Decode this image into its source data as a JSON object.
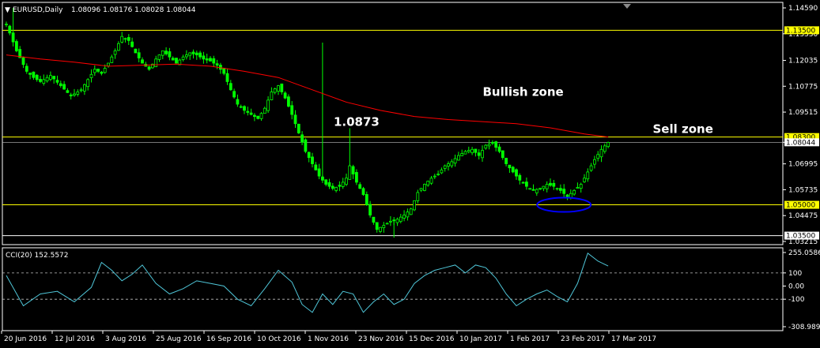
{
  "window": {
    "symbol_caption": "EURUSD,Daily",
    "ohlc_caption": "1.08096 1.08176 1.08028 1.08044",
    "menu_glyph": "▼"
  },
  "chart_data": [
    {
      "type": "candlestick",
      "title": "EURUSD,Daily",
      "ylim": [
        1.03215,
        1.1459
      ],
      "y_ticks": [
        "1.14590",
        "1.13330",
        "1.12035",
        "1.10775",
        "1.09515",
        "1.08044",
        "1.06995",
        "1.05735",
        "1.04475",
        "1.03215"
      ],
      "x_ticks": [
        "20 Jun 2016",
        "12 Jul 2016",
        "3 Aug 2016",
        "25 Aug 2016",
        "16 Sep 2016",
        "10 Oct 2016",
        "1 Nov 2016",
        "23 Nov 2016",
        "15 Dec 2016",
        "10 Jan 2017",
        "1 Feb 2017",
        "23 Feb 2017",
        "17 Mar 2017"
      ],
      "close_path": [
        [
          0,
          1.138
        ],
        [
          3,
          1.125
        ],
        [
          6,
          1.115
        ],
        [
          8,
          1.112
        ],
        [
          10,
          1.11
        ],
        [
          13,
          1.113
        ],
        [
          16,
          1.108
        ],
        [
          19,
          1.103
        ],
        [
          22,
          1.106
        ],
        [
          24,
          1.111
        ],
        [
          26,
          1.116
        ],
        [
          28,
          1.114
        ],
        [
          30,
          1.119
        ],
        [
          32,
          1.125
        ],
        [
          34,
          1.132
        ],
        [
          36,
          1.13
        ],
        [
          38,
          1.124
        ],
        [
          40,
          1.119
        ],
        [
          42,
          1.116
        ],
        [
          44,
          1.121
        ],
        [
          46,
          1.125
        ],
        [
          48,
          1.122
        ],
        [
          50,
          1.119
        ],
        [
          52,
          1.122
        ],
        [
          54,
          1.124
        ],
        [
          56,
          1.123
        ],
        [
          58,
          1.121
        ],
        [
          60,
          1.12
        ],
        [
          62,
          1.118
        ],
        [
          64,
          1.114
        ],
        [
          66,
          1.106
        ],
        [
          68,
          1.099
        ],
        [
          70,
          1.096
        ],
        [
          72,
          1.094
        ],
        [
          74,
          1.092
        ],
        [
          76,
          1.097
        ],
        [
          78,
          1.105
        ],
        [
          80,
          1.108
        ],
        [
          82,
          1.102
        ],
        [
          84,
          1.094
        ],
        [
          86,
          1.085
        ],
        [
          88,
          1.076
        ],
        [
          90,
          1.07
        ],
        [
          92,
          1.064
        ],
        [
          94,
          1.06
        ],
        [
          96,
          1.058
        ],
        [
          98,
          1.059
        ],
        [
          100,
          1.063
        ],
        [
          101,
          1.069
        ],
        [
          103,
          1.061
        ],
        [
          105,
          1.055
        ],
        [
          107,
          1.045
        ],
        [
          109,
          1.038
        ],
        [
          111,
          1.04
        ],
        [
          113,
          1.042
        ],
        [
          115,
          1.043
        ],
        [
          117,
          1.045
        ],
        [
          119,
          1.048
        ],
        [
          121,
          1.056
        ],
        [
          123,
          1.06
        ],
        [
          125,
          1.063
        ],
        [
          127,
          1.065
        ],
        [
          129,
          1.069
        ],
        [
          131,
          1.071
        ],
        [
          133,
          1.074
        ],
        [
          135,
          1.076
        ],
        [
          137,
          1.077
        ],
        [
          139,
          1.074
        ],
        [
          141,
          1.079
        ],
        [
          143,
          1.08
        ],
        [
          145,
          1.076
        ],
        [
          147,
          1.07
        ],
        [
          149,
          1.066
        ],
        [
          151,
          1.062
        ],
        [
          153,
          1.059
        ],
        [
          155,
          1.057
        ],
        [
          157,
          1.058
        ],
        [
          159,
          1.06
        ],
        [
          161,
          1.059
        ],
        [
          163,
          1.057
        ],
        [
          165,
          1.054
        ],
        [
          167,
          1.057
        ],
        [
          169,
          1.06
        ],
        [
          171,
          1.066
        ],
        [
          173,
          1.072
        ],
        [
          175,
          1.077
        ],
        [
          177,
          1.0804
        ]
      ],
      "moving_average": [
        [
          0,
          1.123
        ],
        [
          10,
          1.121
        ],
        [
          20,
          1.1195
        ],
        [
          30,
          1.1175
        ],
        [
          40,
          1.118
        ],
        [
          50,
          1.1185
        ],
        [
          60,
          1.1175
        ],
        [
          70,
          1.115
        ],
        [
          80,
          1.112
        ],
        [
          90,
          1.106
        ],
        [
          100,
          1.1
        ],
        [
          110,
          1.096
        ],
        [
          120,
          1.093
        ],
        [
          130,
          1.0915
        ],
        [
          140,
          1.0905
        ],
        [
          150,
          1.0895
        ],
        [
          160,
          1.0875
        ],
        [
          170,
          1.0845
        ],
        [
          177,
          1.083
        ]
      ],
      "horizontal_levels": [
        {
          "value": 1.135,
          "label": "1.13500",
          "color": "#ffff00"
        },
        {
          "value": 1.083,
          "label": "1.08300",
          "color": "#ffff00"
        },
        {
          "value": 1.05,
          "label": "1.05000",
          "color": "#ffff00"
        },
        {
          "value": 1.035,
          "label": "1.03500",
          "color": "#ffffff"
        }
      ],
      "current_price": {
        "value": 1.08044,
        "label": "1.08044"
      },
      "annotations": [
        {
          "text": "1.0873",
          "x": 103,
          "y": 1.0885
        },
        {
          "text": "Bullish zone",
          "x": 152,
          "y": 1.103
        },
        {
          "text": "Sell zone",
          "x": 199,
          "y": 1.085
        }
      ],
      "ellipse": {
        "x": 164,
        "y": 1.05,
        "color": "#0000ff"
      },
      "colors": {
        "candle": "#00ff00",
        "moving_average": "#ff0000",
        "axis": "#ffffff",
        "background": "#000000"
      }
    },
    {
      "type": "line",
      "title": "CCI(20) 152.5572",
      "ylim": [
        -308.9891,
        255.0586
      ],
      "y_ticks": [
        "255.0586",
        "100",
        "0.00",
        "-100",
        "-308.9891"
      ],
      "levels": [
        100,
        -100
      ],
      "x": [
        0,
        5,
        10,
        15,
        20,
        25,
        28,
        31,
        34,
        37,
        40,
        44,
        48,
        52,
        56,
        60,
        64,
        68,
        72,
        76,
        80,
        84,
        87,
        90,
        93,
        96,
        99,
        102,
        105,
        108,
        111,
        114,
        117,
        120,
        123,
        126,
        129,
        132,
        135,
        138,
        141,
        144,
        147,
        150,
        153,
        156,
        159,
        162,
        165,
        168,
        171,
        174,
        177
      ],
      "values": [
        80,
        -150,
        -60,
        -40,
        -120,
        -10,
        180,
        120,
        40,
        90,
        160,
        20,
        -60,
        -20,
        40,
        20,
        0,
        -100,
        -150,
        -20,
        120,
        30,
        -140,
        -200,
        -60,
        -140,
        -40,
        -60,
        -200,
        -120,
        -60,
        -140,
        -100,
        20,
        80,
        120,
        140,
        160,
        100,
        160,
        140,
        60,
        -60,
        -150,
        -100,
        -60,
        -30,
        -80,
        -120,
        20,
        250,
        190,
        152.56
      ],
      "color": "#4fc6d8"
    }
  ]
}
